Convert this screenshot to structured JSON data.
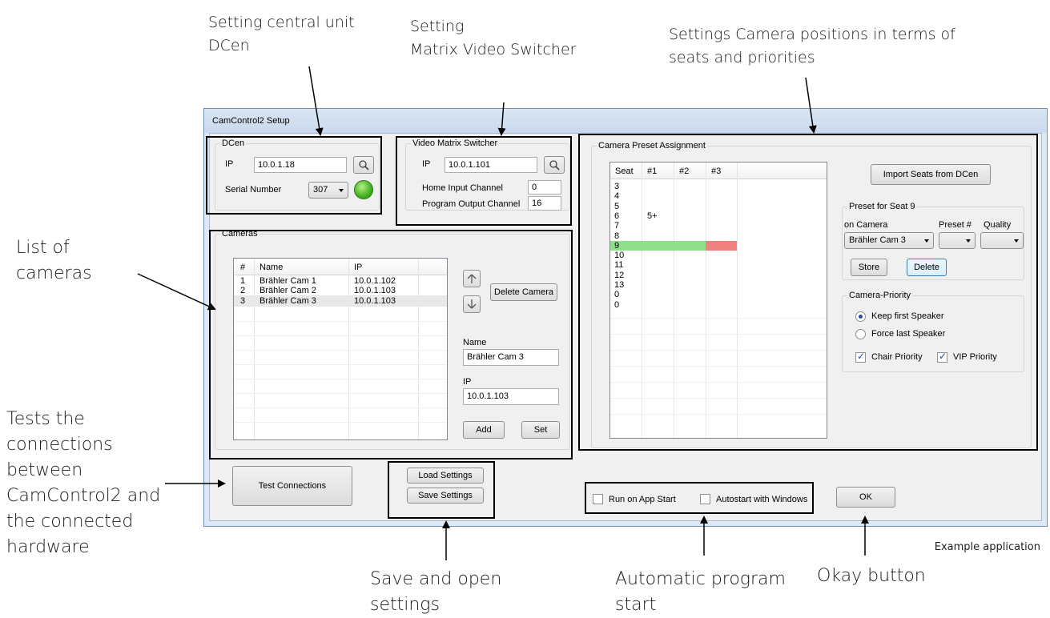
{
  "annotations": {
    "dcen": "Setting central unit\nDCen",
    "matrix": "Setting\nMatrix Video Switcher",
    "camera_positions": "Settings Camera positions in terms of\nseats and priorities",
    "cameras_list": "List of\ncameras",
    "tests": "Tests the\nconnections\nbetween\nCamControl2 and\nthe connected\nhardware",
    "save_open": "Save and open\nsettings",
    "autostart": "Automatic program\nstart",
    "okay": "Okay button"
  },
  "caption": "Example application",
  "window": {
    "title": "CamControl2 Setup"
  },
  "dcen": {
    "group": "DCen",
    "ip_label": "IP",
    "ip": "10.0.1.18",
    "serial_label": "Serial Number",
    "serial": "307"
  },
  "matrix": {
    "group": "Video Matrix Switcher",
    "ip_label": "IP",
    "ip": "10.0.1.101",
    "home_label": "Home Input Channel",
    "home": "0",
    "program_label": "Program Output Channel",
    "program": "16"
  },
  "cameras": {
    "group": "Cameras",
    "columns": [
      "#",
      "Name",
      "IP"
    ],
    "rows": [
      {
        "n": "1",
        "name": "Brähler Cam 1",
        "ip": "10.0.1.102"
      },
      {
        "n": "2",
        "name": "Brähler Cam 2",
        "ip": "10.0.1.103"
      },
      {
        "n": "3",
        "name": "Brähler Cam 3",
        "ip": "10.0.1.103"
      }
    ],
    "delete_label": "Delete Camera",
    "name_label": "Name",
    "name_value": "Brähler Cam 3",
    "ip_label": "IP",
    "ip_value": "10.0.1.103",
    "add_label": "Add",
    "set_label": "Set"
  },
  "preset": {
    "group": "Camera Preset Assignment",
    "columns": [
      "Seat",
      "#1",
      "#2",
      "#3"
    ],
    "seats": [
      "3",
      "4",
      "5",
      "6",
      "7",
      "8",
      "9",
      "10",
      "11",
      "12",
      "13",
      "0",
      "0"
    ],
    "seat6_cam1": "5+",
    "import_label": "Import Seats from DCen",
    "preset_group": "Preset for Seat 9",
    "on_camera_label": "on Camera",
    "preset_no_label": "Preset #",
    "quality_label": "Quality",
    "camera_value": "Brähler Cam 3",
    "store_label": "Store",
    "delete_label": "Delete",
    "priority_group": "Camera-Priority",
    "keep_first": "Keep first Speaker",
    "force_last": "Force last Speaker",
    "chair_priority": "Chair Priority",
    "vip_priority": "VIP Priority"
  },
  "bottom": {
    "test_label": "Test Connections",
    "load_label": "Load Settings",
    "save_label": "Save Settings",
    "run_on_start": "Run on App Start",
    "autostart": "Autostart with Windows",
    "ok_label": "OK"
  },
  "colors": {
    "row_green": "#8fe08a",
    "row_red": "#f08080",
    "led_green": "#3fb21f"
  }
}
